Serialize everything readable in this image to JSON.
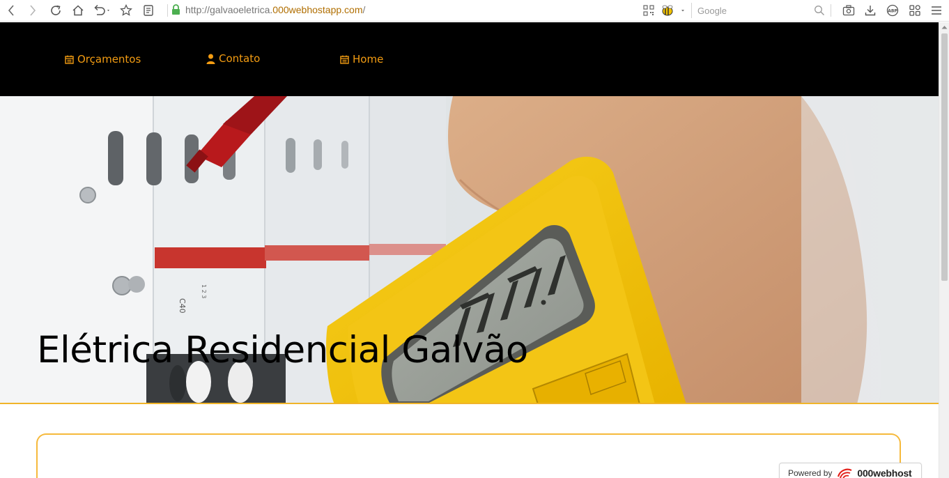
{
  "browser": {
    "url_prefix": "http://galvaoeletrica.",
    "url_domain": "000webhostapp.com",
    "url_suffix": "/",
    "search_placeholder": "Google"
  },
  "nav": {
    "items": [
      {
        "label": "Orçamentos",
        "icon": "calendar-icon"
      },
      {
        "label": "Contato",
        "icon": "user-icon"
      },
      {
        "label": "Home",
        "icon": "calendar-icon"
      }
    ]
  },
  "hero": {
    "title": "Elétrica Residencial Galvão",
    "display_reading": "00 1.8"
  },
  "footer_badge": {
    "label": "Powered by",
    "brand": "000webhost"
  },
  "colors": {
    "nav_background": "#000000",
    "accent": "#f39c12",
    "card_border": "#f6b93b",
    "multimeter": "#f4c20d"
  }
}
